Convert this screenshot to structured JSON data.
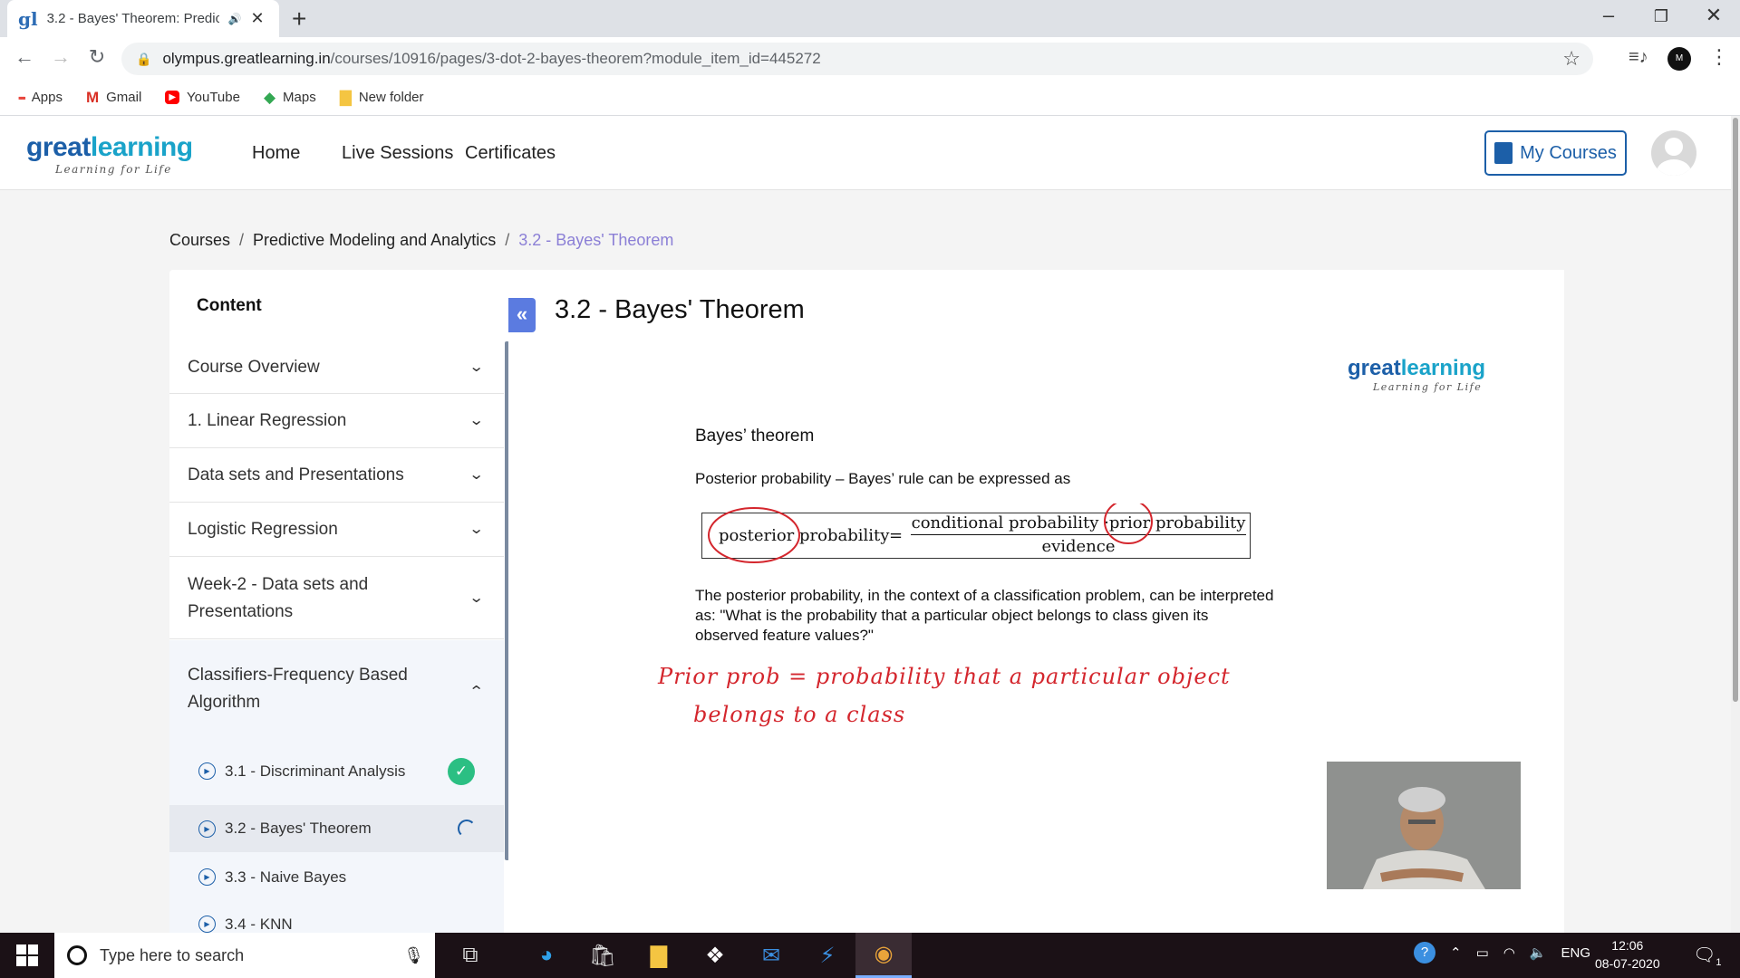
{
  "browser": {
    "tab_title": "3.2 - Bayes' Theorem: Predict",
    "tab_favicon": "gl",
    "url_host": "olympus.greatlearning.in",
    "url_path": "/courses/10916/pages/3-dot-2-bayes-theorem?module_item_id=445272",
    "profile_initial": "M"
  },
  "bookmarks": [
    {
      "label": "Apps",
      "icon": "apps-grid-icon"
    },
    {
      "label": "Gmail",
      "icon": "gmail-icon"
    },
    {
      "label": "YouTube",
      "icon": "youtube-icon"
    },
    {
      "label": "Maps",
      "icon": "maps-icon"
    },
    {
      "label": "New folder",
      "icon": "folder-icon"
    }
  ],
  "site": {
    "logo_word_a": "great",
    "logo_word_b": "learning",
    "logo_tagline": "Learning for Life",
    "nav": [
      "Home",
      "Live Sessions",
      "Certificates"
    ],
    "my_courses": "My Courses",
    "brand_color": "#1c5fa8"
  },
  "breadcrumb": {
    "items": [
      "Courses",
      "Predictive Modeling and Analytics"
    ],
    "current": "3.2 - Bayes' Theorem",
    "sep": "/"
  },
  "sidebar": {
    "heading": "Content",
    "modules": [
      {
        "label": "Course Overview"
      },
      {
        "label": "1. Linear Regression"
      },
      {
        "label": "Data sets and Presentations"
      },
      {
        "label": "Logistic Regression"
      },
      {
        "label": "Week-2 - Data sets and Presentations"
      },
      {
        "label": "Classifiers-Frequency Based Algorithm"
      }
    ],
    "items": [
      {
        "label": "3.1 - Discriminant Analysis",
        "status": "complete"
      },
      {
        "label": "3.2 - Bayes' Theorem",
        "status": "in-progress"
      },
      {
        "label": "3.3 - Naive Bayes",
        "status": "none"
      },
      {
        "label": "3.4 - KNN",
        "status": "none"
      }
    ]
  },
  "page": {
    "title": "3.2 - Bayes' Theorem",
    "slide": {
      "logo_word_a": "great",
      "logo_word_b": "learning",
      "logo_tagline": "Learning for Life",
      "heading": "Bayes’ theorem",
      "posterior_line": "Posterior probability – Bayes’ rule can be expressed as",
      "formula_lhs_a": "posterior",
      "formula_lhs_b": "probability",
      "formula_eq": "=",
      "formula_num_a": "conditional probability ·",
      "formula_num_b": "prior",
      "formula_num_c": "probability",
      "formula_den": "evidence",
      "paragraph": "The posterior probability, in the context of a classification problem, can be interpreted as: \"What is the probability that a particular object belongs to class given its observed feature values?\"",
      "ink_line1": "Prior prob  =  probability that a particular object",
      "ink_line2": "belongs to a class",
      "ink_color": "#d4262d"
    }
  },
  "taskbar": {
    "search_placeholder": "Type here to search",
    "lang": "ENG",
    "time": "12:06",
    "date": "08-07-2020",
    "notification_count": "1"
  }
}
